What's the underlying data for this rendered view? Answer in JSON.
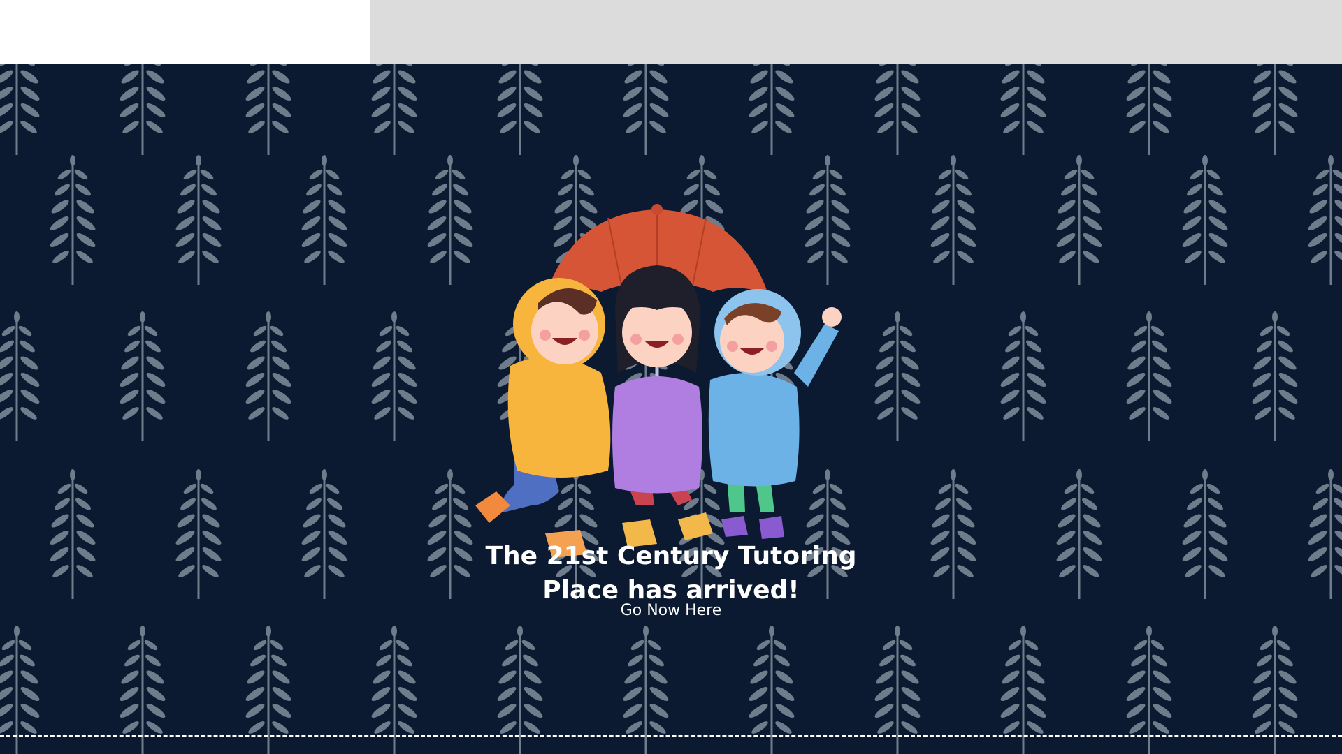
{
  "header": {
    "left_panel_color": "#ffffff",
    "right_panel_color": "#dcdcdc"
  },
  "hero": {
    "background_color": "#0b1a30",
    "pattern_icon": "fern-leaf-icon",
    "pattern_color": "#6f7c8c",
    "illustration": "three-kids-under-umbrella-illustration",
    "headline_line1": "The 21st Century Tutoring",
    "headline_line2": "Place has arrived!",
    "cta_label": "Go Now Here",
    "divider_color": "#ffffff"
  }
}
